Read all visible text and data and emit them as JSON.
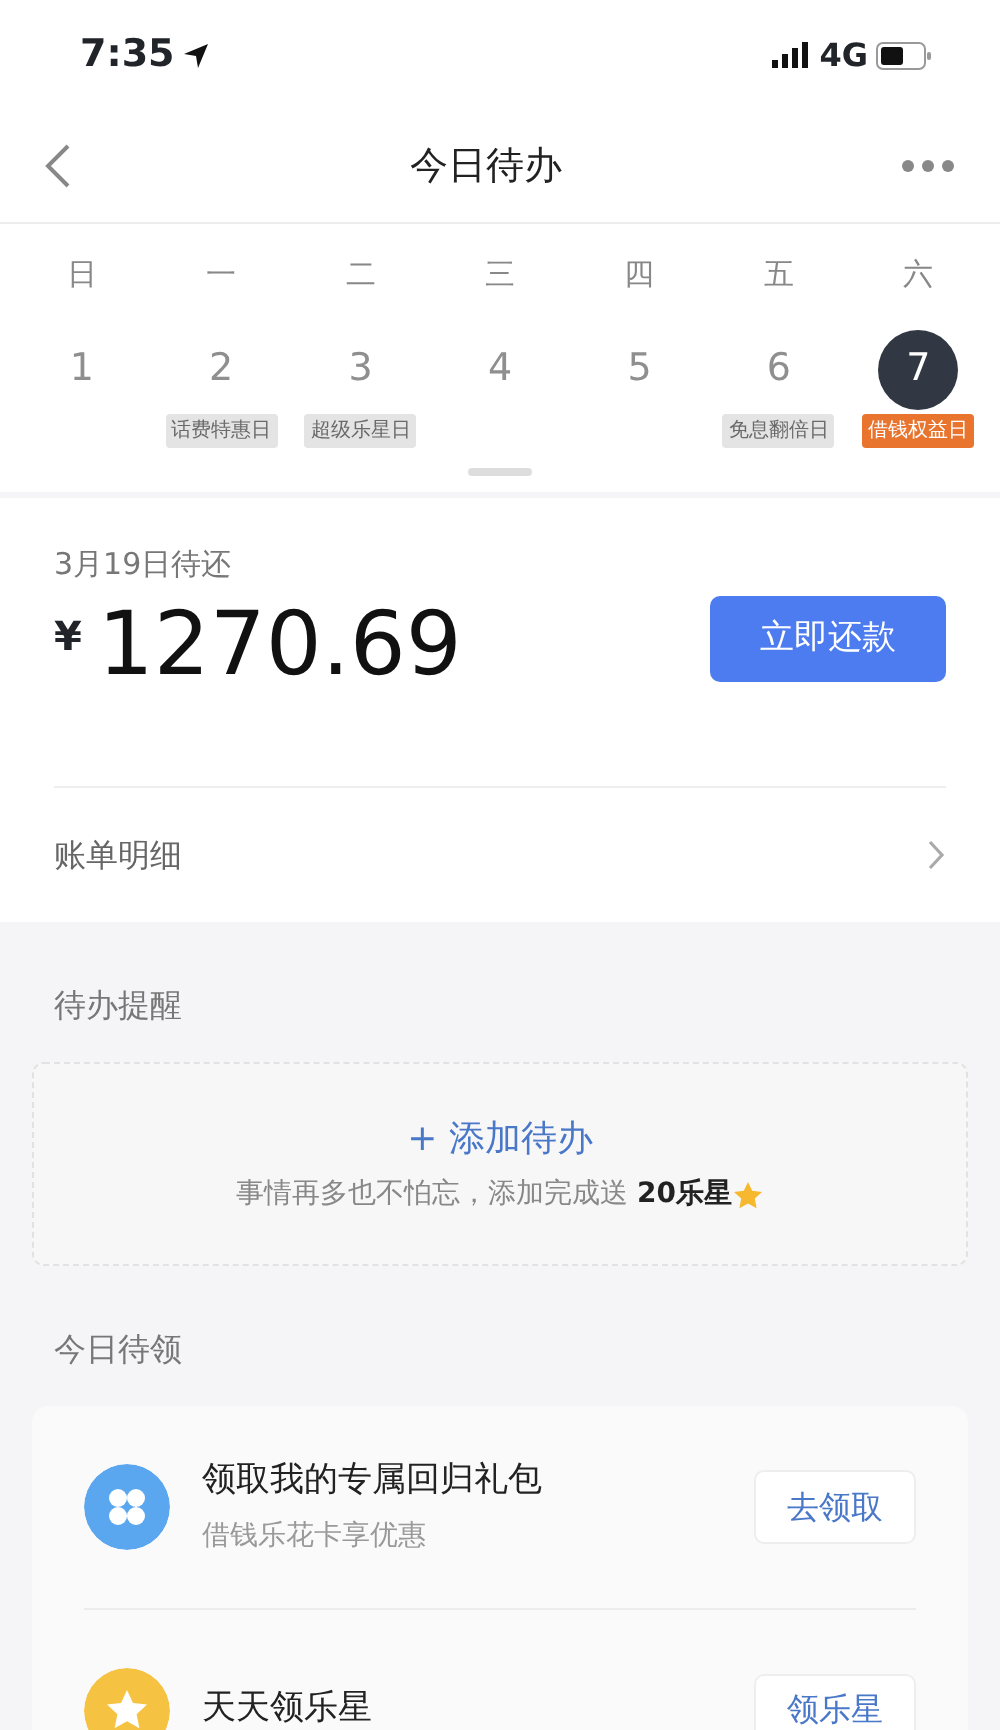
{
  "status_bar": {
    "time": "7:35",
    "network": "4G"
  },
  "nav": {
    "title": "今日待办"
  },
  "calendar": {
    "weekdays": [
      "日",
      "一",
      "二",
      "三",
      "四",
      "五",
      "六"
    ],
    "days": [
      {
        "number": "1",
        "selected": false
      },
      {
        "number": "2",
        "tag": "话费特惠日",
        "selected": false
      },
      {
        "number": "3",
        "tag": "超级乐星日",
        "selected": false
      },
      {
        "number": "4",
        "selected": false
      },
      {
        "number": "5",
        "selected": false
      },
      {
        "number": "6",
        "tag": "免息翻倍日",
        "selected": false
      },
      {
        "number": "7",
        "tag": "借钱权益日",
        "selected": true
      }
    ]
  },
  "bill": {
    "due_label": "3月19日待还",
    "currency": "¥",
    "amount": "1270.69",
    "button": "立即还款",
    "detail_link": "账单明细"
  },
  "reminders": {
    "heading": "待办提醒",
    "add_label": "+ 添加待办",
    "hint": "事情再多也不怕忘，添加完成送 **20乐星**"
  },
  "claims": {
    "heading": "今日待领",
    "items": [
      {
        "kind": "gift",
        "title": "领取我的专属回归礼包",
        "subtitle": "借钱乐花卡享优惠",
        "button": "去领取",
        "color": "#5aa7ef"
      },
      {
        "kind": "star",
        "title": "天天领乐星",
        "button": "领乐星",
        "color": "#f5c242"
      }
    ]
  }
}
